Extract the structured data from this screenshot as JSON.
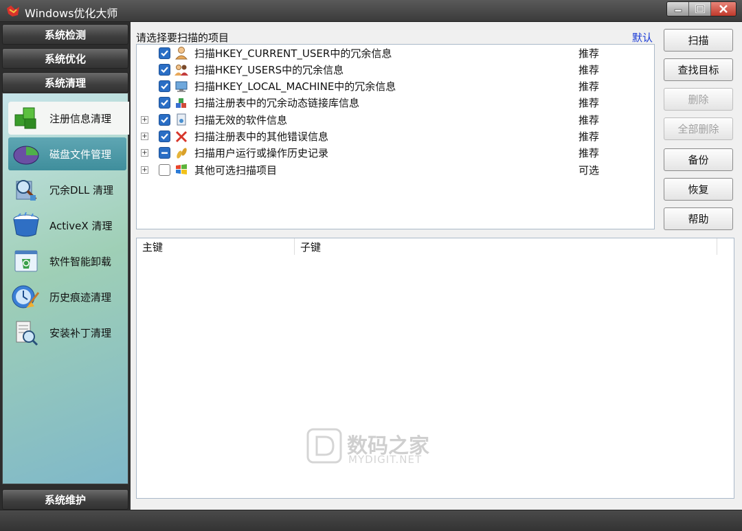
{
  "window": {
    "title": "Windows优化大师",
    "controls": {
      "minimize": "minimize-icon",
      "maximize": "maximize-icon",
      "close": "close-icon"
    }
  },
  "sidebar": {
    "categories": [
      {
        "label": "系统检测"
      },
      {
        "label": "系统优化"
      },
      {
        "label": "系统清理"
      },
      {
        "label": "系统维护"
      }
    ],
    "items": [
      {
        "label": "注册信息清理",
        "icon": "registry-cubes-icon",
        "state": "active"
      },
      {
        "label": "磁盘文件管理",
        "icon": "disk-pie-icon",
        "state": "hover"
      },
      {
        "label": "冗余DLL 清理",
        "icon": "dll-magnifier-icon",
        "state": "normal"
      },
      {
        "label": "ActiveX 清理",
        "icon": "activex-bucket-icon",
        "state": "normal"
      },
      {
        "label": "软件智能卸载",
        "icon": "uninstall-recycle-icon",
        "state": "normal"
      },
      {
        "label": "历史痕迹清理",
        "icon": "history-broom-icon",
        "state": "normal"
      },
      {
        "label": "安装补丁清理",
        "icon": "patch-installer-icon",
        "state": "normal"
      }
    ]
  },
  "main": {
    "prompt": "请选择要扫描的项目",
    "default_link": "默认",
    "scan_items": [
      {
        "label": "扫描HKEY_CURRENT_USER中的冗余信息",
        "status": "推荐",
        "check": "checked",
        "expandable": false,
        "icon": "user-icon"
      },
      {
        "label": "扫描HKEY_USERS中的冗余信息",
        "status": "推荐",
        "check": "checked",
        "expandable": false,
        "icon": "users-icon"
      },
      {
        "label": "扫描HKEY_LOCAL_MACHINE中的冗余信息",
        "status": "推荐",
        "check": "checked",
        "expandable": false,
        "icon": "computer-icon"
      },
      {
        "label": "扫描注册表中的冗余动态链接库信息",
        "status": "推荐",
        "check": "checked",
        "expandable": false,
        "icon": "dll-blocks-icon"
      },
      {
        "label": "扫描无效的软件信息",
        "status": "推荐",
        "check": "checked",
        "expandable": true,
        "icon": "software-icon"
      },
      {
        "label": "扫描注册表中的其他错误信息",
        "status": "推荐",
        "check": "checked",
        "expandable": true,
        "icon": "error-x-icon"
      },
      {
        "label": "扫描用户运行或操作历史记录",
        "status": "推荐",
        "check": "partial",
        "expandable": true,
        "icon": "footprints-icon"
      },
      {
        "label": "其他可选扫描项目",
        "status": "可选",
        "check": "empty",
        "expandable": true,
        "icon": "windows-flag-icon"
      }
    ],
    "columns": {
      "primary_key": "主键",
      "sub_key": "子键"
    }
  },
  "buttons": [
    {
      "label": "扫描",
      "enabled": true
    },
    {
      "label": "查找目标",
      "enabled": true
    },
    {
      "label": "删除",
      "enabled": false
    },
    {
      "label": "全部删除",
      "enabled": false
    },
    {
      "label": "备份",
      "enabled": true
    },
    {
      "label": "恢复",
      "enabled": true
    },
    {
      "label": "帮助",
      "enabled": true
    }
  ],
  "watermark": {
    "text": "数码之家",
    "sub": "MYDIGIT.NET"
  }
}
